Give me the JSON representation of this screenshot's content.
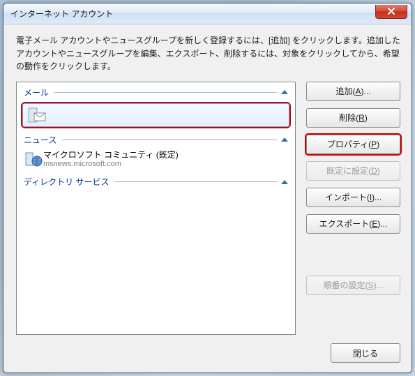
{
  "title": "インターネット アカウント",
  "instructions": "電子メール アカウントやニュースグループを新しく登録するには、[追加] をクリックします。追加したアカウントやニュースグループを編集、エクスポート、削除するには、対象をクリックしてから、希望の動作をクリックします。",
  "sections": {
    "mail_label": "メール",
    "news_label": "ニュース",
    "directory_label": "ディレクトリ サービス"
  },
  "mail_entry": {
    "label": ""
  },
  "news_entry": {
    "label": "マイクロソフト コミュニティ (既定)",
    "sub": "msnews.microsoft.com"
  },
  "buttons": {
    "add": "追加(A)...",
    "remove": "削除(R)",
    "properties": "プロパティ(P)",
    "set_default": "既定に設定(D)",
    "import": "インポート(I)...",
    "export": "エクスポート(E)...",
    "order": "順番の設定(S)...",
    "close": "閉じる"
  }
}
